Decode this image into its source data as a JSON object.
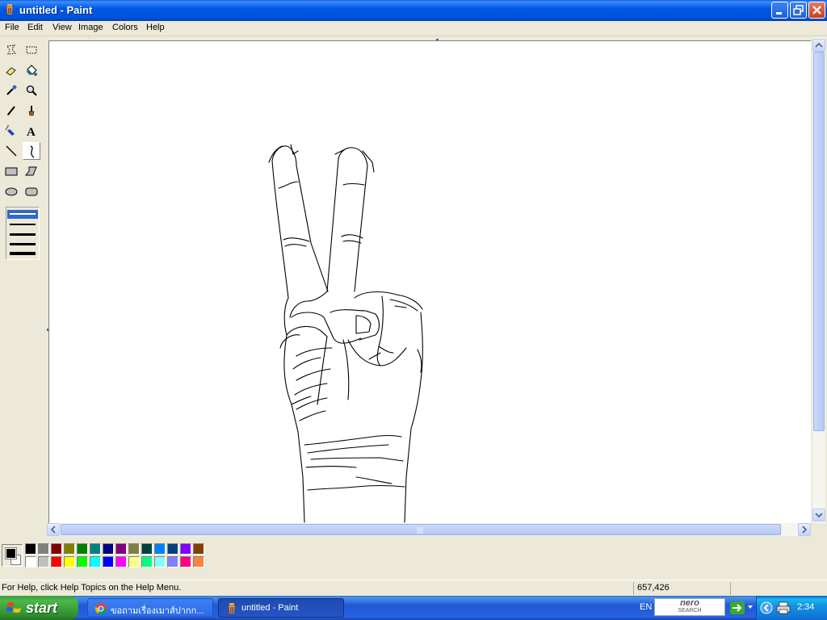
{
  "window": {
    "title": "untitled - Paint"
  },
  "menu": [
    "File",
    "Edit",
    "View",
    "Image",
    "Colors",
    "Help"
  ],
  "tools": [
    "free-form-select",
    "select",
    "eraser",
    "fill-with-color",
    "pick-color",
    "magnifier",
    "pencil",
    "brush",
    "airbrush",
    "text",
    "line",
    "curve",
    "rectangle",
    "polygon",
    "ellipse",
    "rounded-rectangle"
  ],
  "active_tool": "curve",
  "line_widths": [
    1,
    2,
    3,
    4
  ],
  "palette": {
    "foreground": "#000000",
    "background": "#FFFFFF",
    "row1": [
      "#000000",
      "#808080",
      "#800000",
      "#808000",
      "#008000",
      "#008080",
      "#000080",
      "#800080",
      "#808040",
      "#004040",
      "#0080FF",
      "#004080",
      "#8000FF",
      "#804000"
    ],
    "row2": [
      "#FFFFFF",
      "#C0C0C0",
      "#FF0000",
      "#FFFF00",
      "#00FF00",
      "#00FFFF",
      "#0000FF",
      "#FF00FF",
      "#FFFF80",
      "#00FF80",
      "#80FFFF",
      "#8080FF",
      "#FF0080",
      "#FF8040"
    ]
  },
  "status": {
    "help": "For Help, click Help Topics on the Help Menu.",
    "coords": "657,426"
  },
  "taskbar": {
    "start": "start",
    "tasks": [
      {
        "label": "ขอถามเรื่องเมาส์ปากก...",
        "active": false
      },
      {
        "label": "untitled - Paint",
        "active": true
      }
    ],
    "lang": "EN",
    "nero_line1": "nero",
    "nero_line2": "SEARCH",
    "clock": "2:34"
  }
}
